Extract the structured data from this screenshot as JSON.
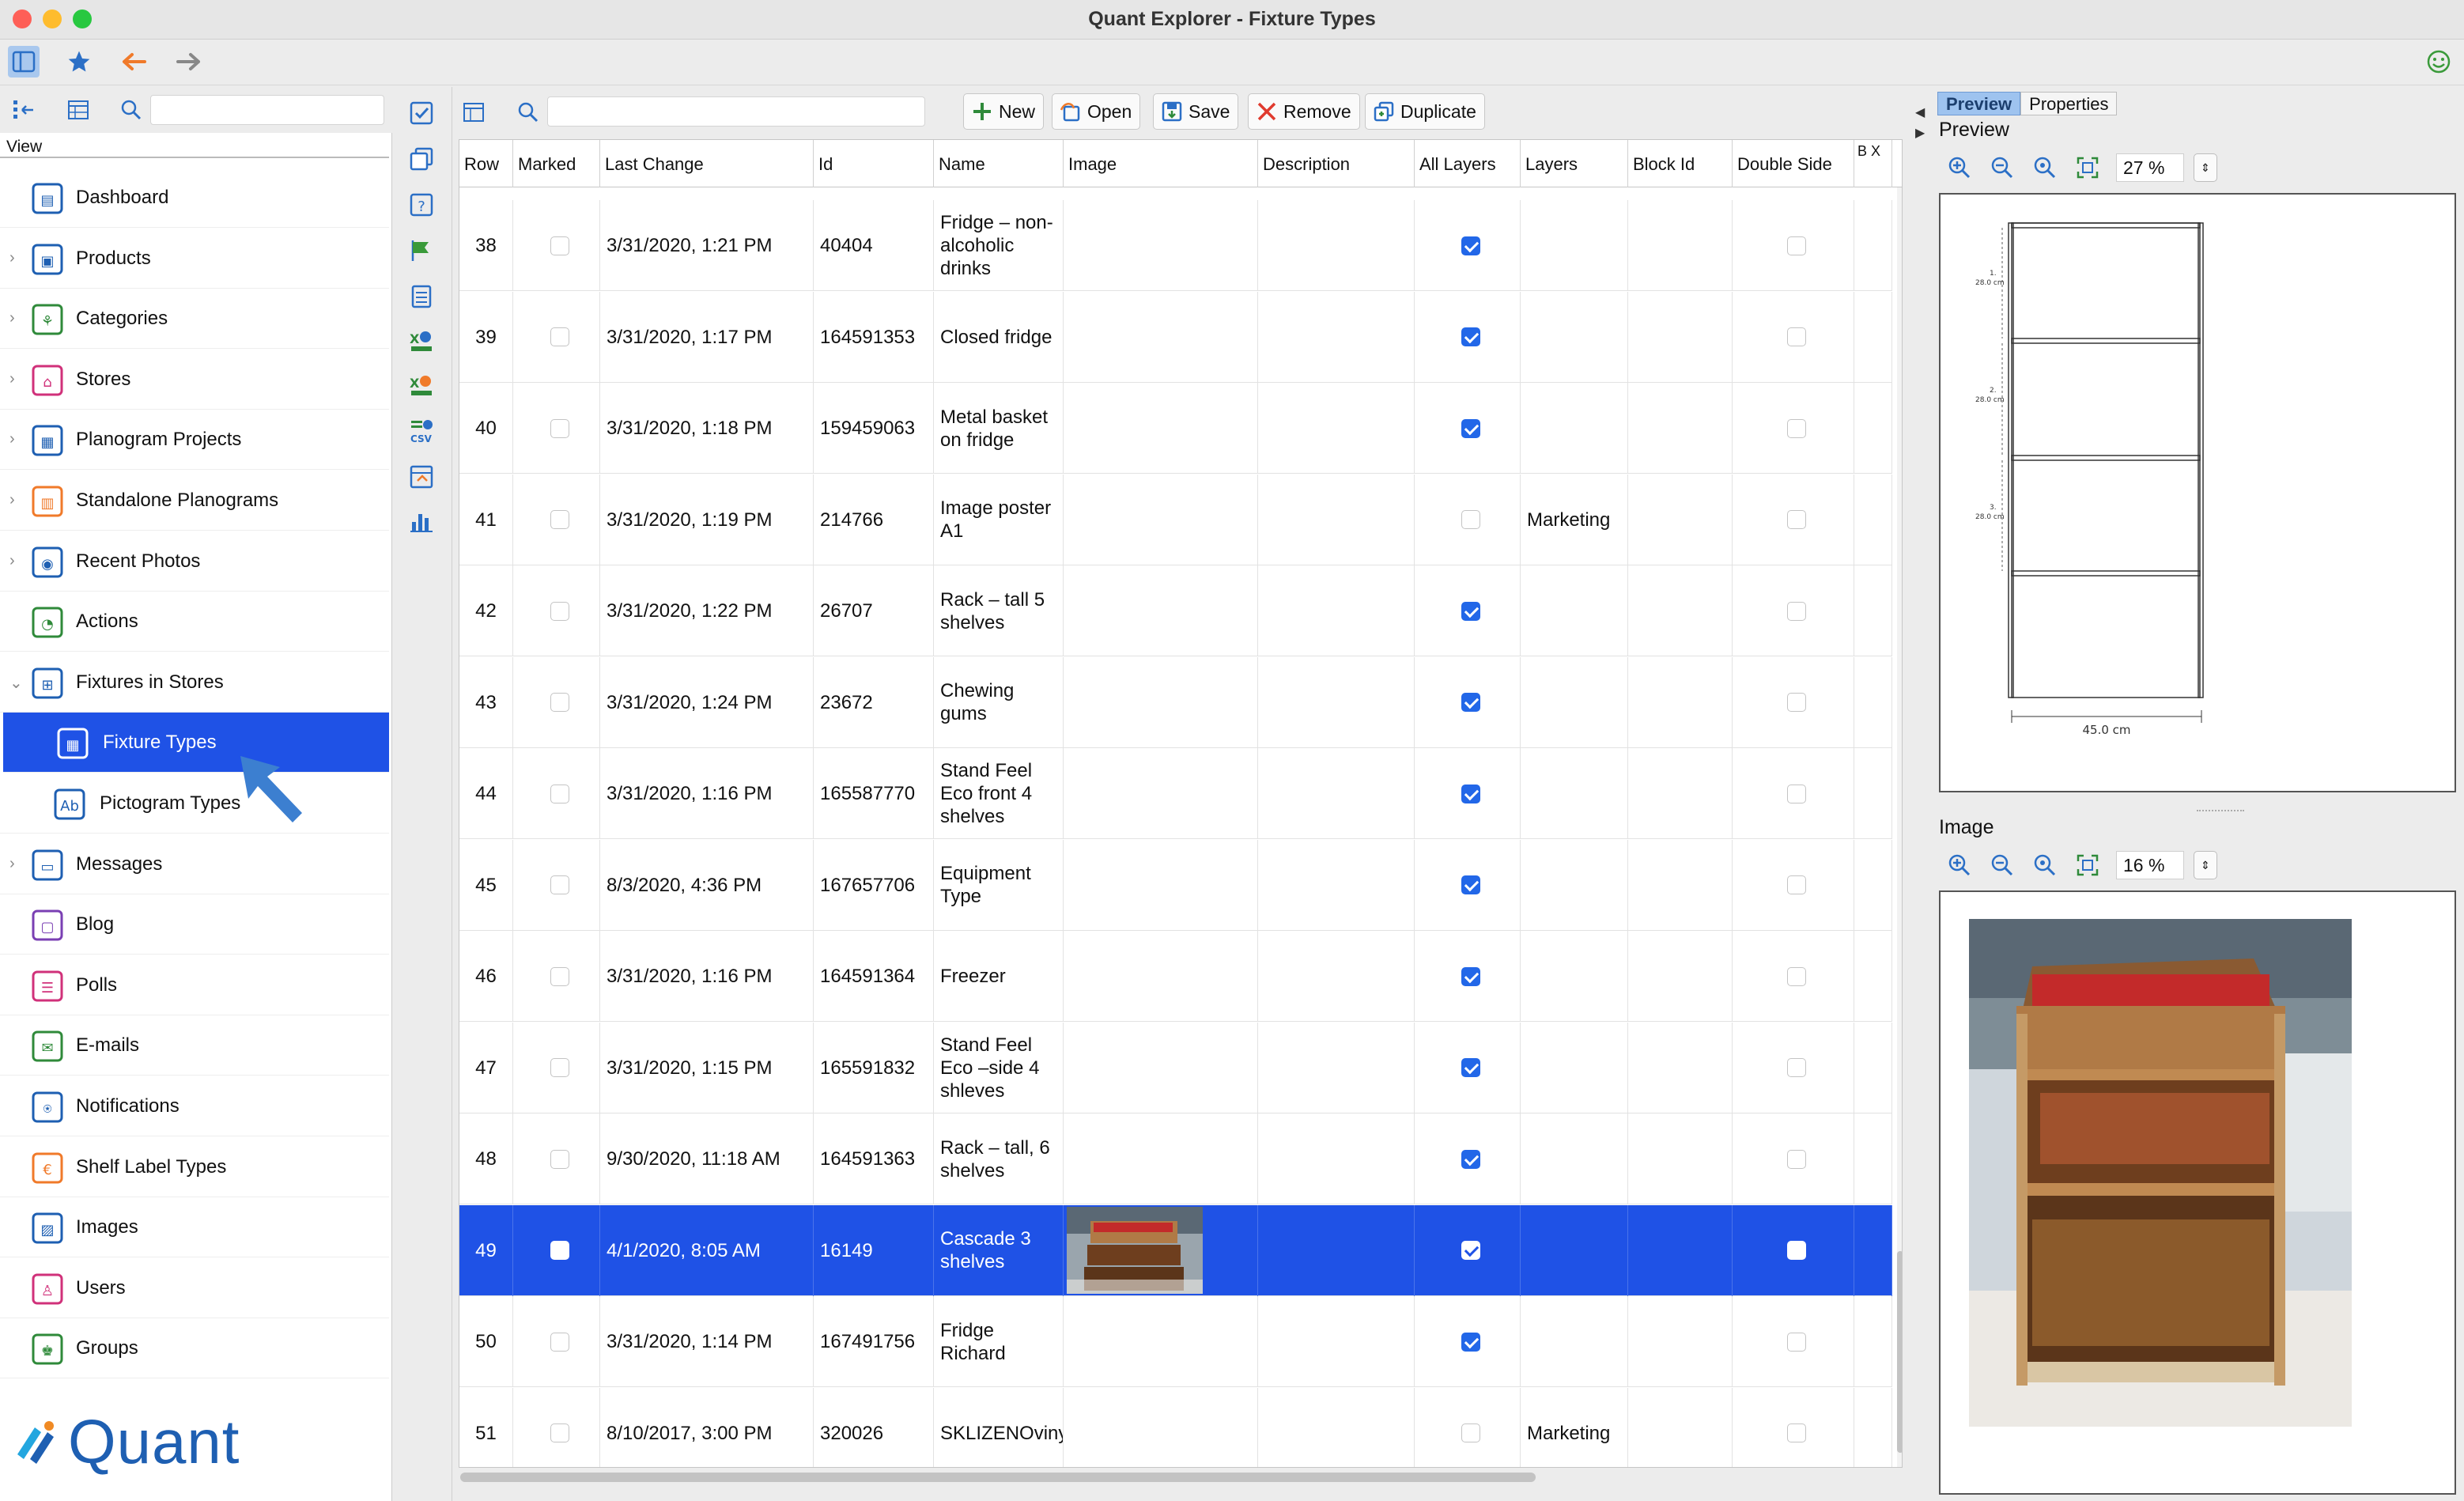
{
  "window": {
    "title": "Quant Explorer - Fixture Types"
  },
  "nav": {
    "view_label": "View",
    "items": [
      {
        "label": "Dashboard",
        "expandable": false
      },
      {
        "label": "Products",
        "expandable": true
      },
      {
        "label": "Categories",
        "expandable": true
      },
      {
        "label": "Stores",
        "expandable": true
      },
      {
        "label": "Planogram Projects",
        "expandable": true
      },
      {
        "label": "Standalone Planograms",
        "expandable": true
      },
      {
        "label": "Recent Photos",
        "expandable": true
      },
      {
        "label": "Actions",
        "expandable": false
      },
      {
        "label": "Fixtures in Stores",
        "expandable": true,
        "expanded": true
      },
      {
        "label": "Fixture Types",
        "sub": true,
        "selected": true
      },
      {
        "label": "Pictogram Types",
        "sub": true
      },
      {
        "label": "Messages",
        "expandable": true
      },
      {
        "label": "Blog",
        "expandable": false
      },
      {
        "label": "Polls",
        "expandable": false
      },
      {
        "label": "E-mails",
        "expandable": false
      },
      {
        "label": "Notifications",
        "expandable": false
      },
      {
        "label": "Shelf Label Types",
        "expandable": false
      },
      {
        "label": "Images",
        "expandable": false
      },
      {
        "label": "Users",
        "expandable": false
      },
      {
        "label": "Groups",
        "expandable": false
      }
    ],
    "logo_text": "Quant"
  },
  "toolbar": {
    "new_label": "New",
    "open_label": "Open",
    "save_label": "Save",
    "remove_label": "Remove",
    "duplicate_label": "Duplicate"
  },
  "table": {
    "columns": [
      "Row",
      "Marked",
      "Last Change",
      "Id",
      "Name",
      "Image",
      "Description",
      "All Layers",
      "Layers",
      "Block Id",
      "Double Side",
      "B X"
    ],
    "rows": [
      {
        "row": "38",
        "marked": false,
        "last_change": "3/31/2020, 1:21 PM",
        "id": "40404",
        "name": "Fridge – non-alcoholic drinks",
        "all_layers": true,
        "layers": "",
        "double_side": false
      },
      {
        "row": "39",
        "marked": false,
        "last_change": "3/31/2020, 1:17 PM",
        "id": "164591353",
        "name": "Closed fridge",
        "all_layers": true,
        "layers": "",
        "double_side": false
      },
      {
        "row": "40",
        "marked": false,
        "last_change": "3/31/2020, 1:18 PM",
        "id": "159459063",
        "name": "Metal basket on fridge",
        "all_layers": true,
        "layers": "",
        "double_side": false
      },
      {
        "row": "41",
        "marked": false,
        "last_change": "3/31/2020, 1:19 PM",
        "id": "214766",
        "name": "Image poster A1",
        "all_layers": false,
        "layers": "Marketing",
        "double_side": false
      },
      {
        "row": "42",
        "marked": false,
        "last_change": "3/31/2020, 1:22 PM",
        "id": "26707",
        "name": "Rack – tall 5 shelves",
        "all_layers": true,
        "layers": "",
        "double_side": false
      },
      {
        "row": "43",
        "marked": false,
        "last_change": "3/31/2020, 1:24 PM",
        "id": "23672",
        "name": "Chewing gums",
        "all_layers": true,
        "layers": "",
        "double_side": false
      },
      {
        "row": "44",
        "marked": false,
        "last_change": "3/31/2020, 1:16 PM",
        "id": "165587770",
        "name": "Stand Feel Eco front 4 shelves",
        "all_layers": true,
        "layers": "",
        "double_side": false
      },
      {
        "row": "45",
        "marked": false,
        "last_change": "8/3/2020, 4:36 PM",
        "id": "167657706",
        "name": "Equipment Type",
        "all_layers": true,
        "layers": "",
        "double_side": false
      },
      {
        "row": "46",
        "marked": false,
        "last_change": "3/31/2020, 1:16 PM",
        "id": "164591364",
        "name": "Freezer",
        "all_layers": true,
        "layers": "",
        "double_side": false
      },
      {
        "row": "47",
        "marked": false,
        "last_change": "3/31/2020, 1:15 PM",
        "id": "165591832",
        "name": "Stand Feel Eco –side 4 shleves",
        "all_layers": true,
        "layers": "",
        "double_side": false
      },
      {
        "row": "48",
        "marked": false,
        "last_change": "9/30/2020, 11:18 AM",
        "id": "164591363",
        "name": "Rack – tall, 6 shelves",
        "all_layers": true,
        "layers": "",
        "double_side": false
      },
      {
        "row": "49",
        "marked": false,
        "last_change": "4/1/2020, 8:05 AM",
        "id": "16149",
        "name": "Cascade 3 shelves",
        "all_layers": true,
        "layers": "",
        "double_side": false,
        "selected": true,
        "has_image": true
      },
      {
        "row": "50",
        "marked": false,
        "last_change": "3/31/2020, 1:14 PM",
        "id": "167491756",
        "name": "Fridge Richard",
        "all_layers": true,
        "layers": "",
        "double_side": false
      },
      {
        "row": "51",
        "marked": false,
        "last_change": "8/10/2017, 3:00 PM",
        "id": "320026",
        "name": "SKLIZENOviny",
        "all_layers": false,
        "layers": "Marketing",
        "double_side": false
      }
    ]
  },
  "right_panel": {
    "tabs": [
      "Preview",
      "Properties"
    ],
    "active_tab": "Preview",
    "preview_label": "Preview",
    "preview_zoom": "27 %",
    "image_label": "Image",
    "image_zoom": "16 %",
    "drawing": {
      "shelf_labels": [
        "1.",
        "2.",
        "3."
      ],
      "shelf_heights": [
        "28.0 cm",
        "28.0 cm",
        "28.0 cm"
      ],
      "width_label": "45.0 cm"
    }
  },
  "colors": {
    "selection": "#1f52e6",
    "checkbox_checked": "#2267e8",
    "brand": "#1e5fb2",
    "close": "#fe5f57",
    "minimize": "#febc2e",
    "zoom": "#28c840"
  }
}
